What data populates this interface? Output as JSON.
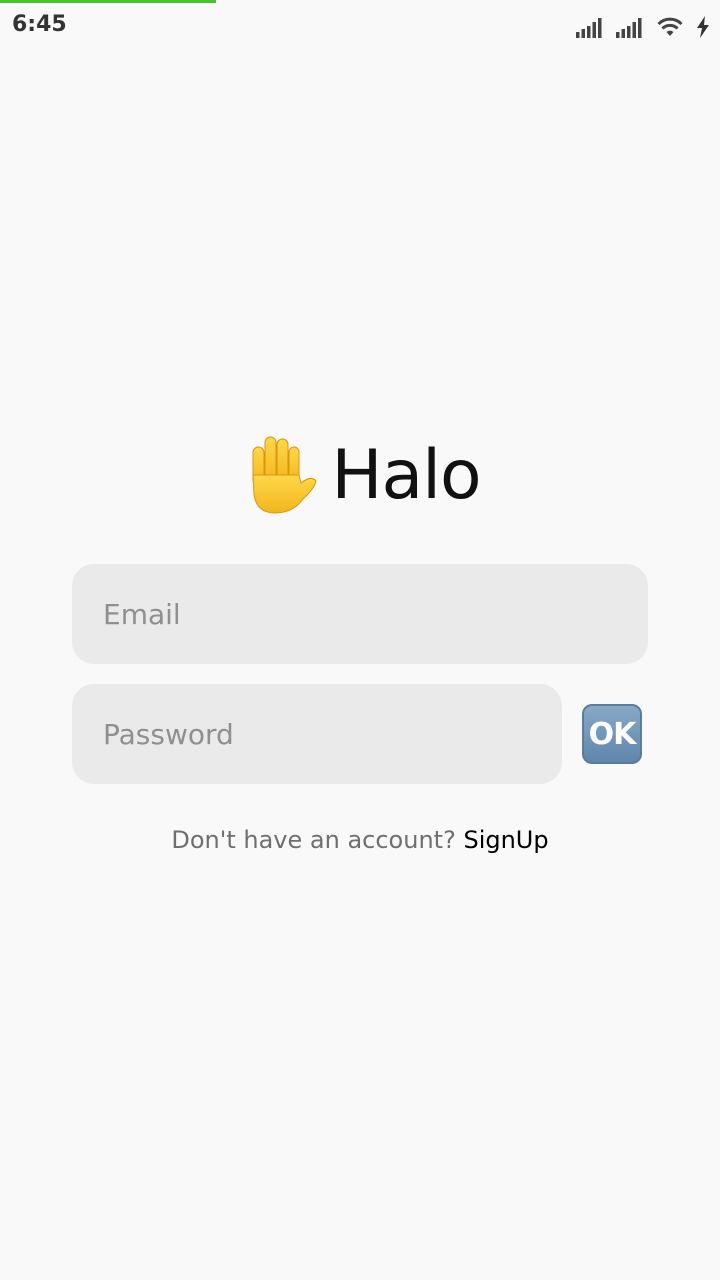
{
  "status_bar": {
    "time": "6:45",
    "icons": [
      "signal-icon",
      "signal-icon",
      "wifi-icon",
      "charging-icon"
    ],
    "load_bar_color": "#4cc22a"
  },
  "hero": {
    "icon": "raised-hand-icon",
    "title": "Halo"
  },
  "form": {
    "email_placeholder": "Email",
    "password_placeholder": "Password",
    "ok_label": "OK"
  },
  "signup": {
    "prompt": "Don't have an account?",
    "link": "SignUp"
  },
  "colors": {
    "background": "#f9f9f9",
    "field_background": "#eaeaea",
    "ok_button": "#6f93b5"
  }
}
